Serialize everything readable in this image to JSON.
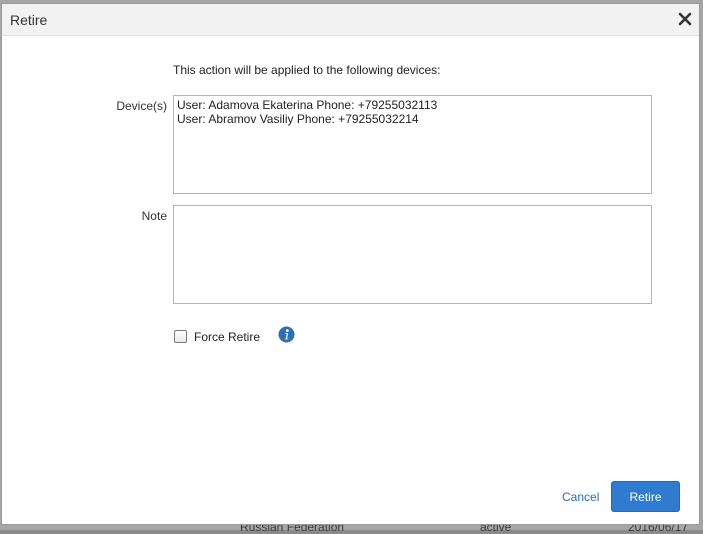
{
  "dialog": {
    "title": "Retire",
    "close_icon": "close-icon",
    "intro_text": "This action will be applied to the following devices:",
    "devices": {
      "label": "Device(s)",
      "items": [
        "User: Adamova Ekaterina Phone: +79255032113",
        "User: Abramov Vasiliy Phone: +79255032214"
      ]
    },
    "note": {
      "label": "Note",
      "value": ""
    },
    "force_retire": {
      "label": "Force Retire",
      "checked": false,
      "info_icon": "info-icon"
    },
    "footer": {
      "cancel_label": "Cancel",
      "retire_label": "Retire"
    },
    "colors": {
      "primary": "#2f7bd0",
      "link": "#2a6fbf",
      "titlebar": "#f2f2f2"
    }
  },
  "background": {
    "fragments": [
      "Russian Federation",
      "active",
      "2016/06/17"
    ]
  }
}
